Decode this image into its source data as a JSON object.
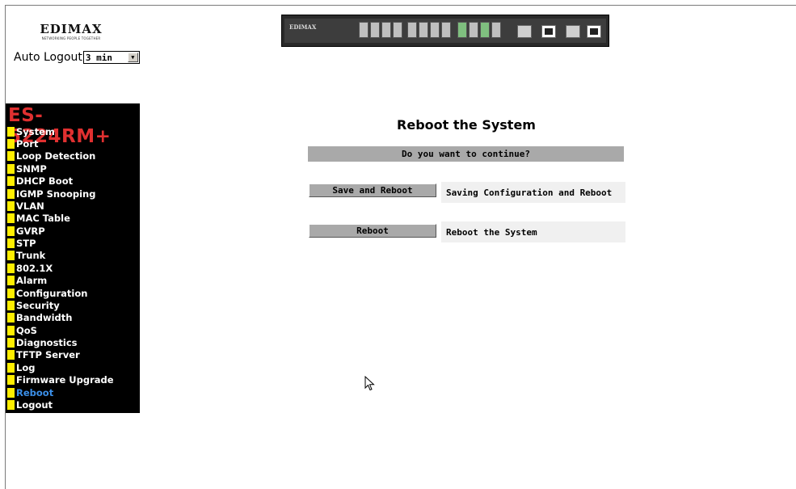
{
  "logo": {
    "brand": "EDIMAX",
    "tagline": "NETWORKING PEOPLE TOGETHER"
  },
  "auto_logout": {
    "label": "Auto Logout",
    "selected": "3 min"
  },
  "switch_image": {
    "brand": "EDIMAX"
  },
  "sidebar": {
    "model": "ES-5224RM+",
    "items": [
      {
        "label": "System"
      },
      {
        "label": "Port"
      },
      {
        "label": "Loop Detection"
      },
      {
        "label": "SNMP"
      },
      {
        "label": "DHCP Boot"
      },
      {
        "label": "IGMP Snooping"
      },
      {
        "label": "VLAN"
      },
      {
        "label": "MAC Table"
      },
      {
        "label": "GVRP"
      },
      {
        "label": "STP"
      },
      {
        "label": "Trunk"
      },
      {
        "label": "802.1X"
      },
      {
        "label": "Alarm"
      },
      {
        "label": "Configuration"
      },
      {
        "label": "Security"
      },
      {
        "label": "Bandwidth"
      },
      {
        "label": "QoS"
      },
      {
        "label": "Diagnostics"
      },
      {
        "label": "TFTP Server"
      },
      {
        "label": "Log"
      },
      {
        "label": "Firmware Upgrade"
      },
      {
        "label": "Reboot"
      },
      {
        "label": "Logout"
      }
    ],
    "active": "Reboot",
    "accent_color": "#ffee00",
    "active_color": "#3b8fe8",
    "model_color": "#e03030"
  },
  "main": {
    "title": "Reboot the System",
    "confirm_text": "Do you want to continue?",
    "actions": [
      {
        "button": "Save and Reboot",
        "description": "Saving Configuration and Reboot"
      },
      {
        "button": "Reboot",
        "description": "Reboot the System"
      }
    ]
  }
}
